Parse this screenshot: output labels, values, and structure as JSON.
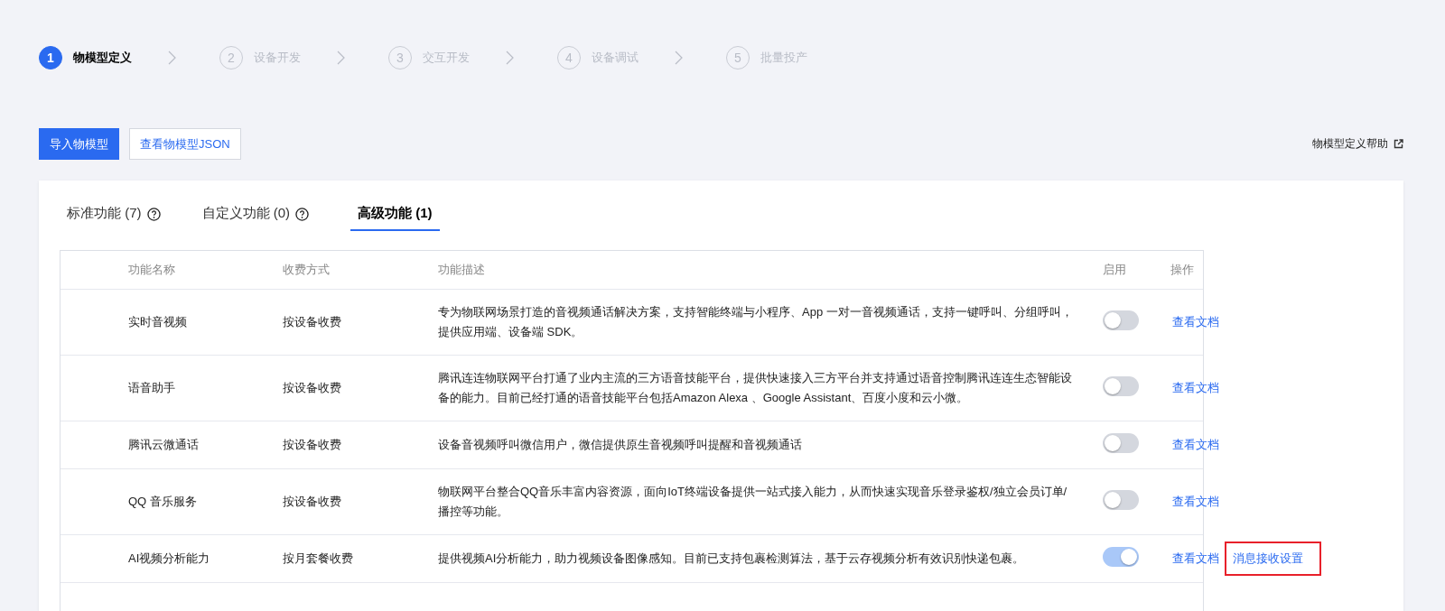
{
  "steps": [
    {
      "number": "1",
      "label": "物模型定义",
      "selected": true
    },
    {
      "number": "2",
      "label": "设备开发",
      "selected": false
    },
    {
      "number": "3",
      "label": "交互开发",
      "selected": false
    },
    {
      "number": "4",
      "label": "设备调试",
      "selected": false
    },
    {
      "number": "5",
      "label": "批量投产",
      "selected": false
    }
  ],
  "toolbar": {
    "buttons": [
      {
        "label": "导入物模型",
        "kind": "primary"
      },
      {
        "label": "查看物模型JSON",
        "kind": "secondary"
      }
    ],
    "help_link": "物模型定义帮助"
  },
  "tabs": [
    {
      "label": "标准功能 (7)",
      "selected": false,
      "help": true
    },
    {
      "label": "自定义功能 (0)",
      "selected": false,
      "help": true
    },
    {
      "label": "高级功能 (1)",
      "selected": true,
      "help": false
    }
  ],
  "table": {
    "columns": [
      "功能名称",
      "收费方式",
      "功能描述",
      "启用",
      "操作"
    ],
    "rows": [
      {
        "name": "实时音视频",
        "billing": "按设备收费",
        "description": "专为物联网场景打造的音视频通话解决方案，支持智能终端与小程序、App 一对一音视频通话，支持一键呼叫、分组呼叫，提供应用端、设备端 SDK。",
        "on": false,
        "actions": [
          {
            "label": "查看文档",
            "highlighted": false
          }
        ]
      },
      {
        "name": "语音助手",
        "billing": "按设备收费",
        "description": "腾讯连连物联网平台打通了业内主流的三方语音技能平台，提供快速接入三方平台并支持通过语音控制腾讯连连生态智能设备的能力。目前已经打通的语音技能平台包括Amazon Alexa 、Google Assistant、百度小度和云小微。",
        "on": false,
        "actions": [
          {
            "label": "查看文档",
            "highlighted": false
          }
        ]
      },
      {
        "name": "腾讯云微通话",
        "billing": "按设备收费",
        "description": "设备音视频呼叫微信用户，微信提供原生音视频呼叫提醒和音视频通话",
        "on": false,
        "actions": [
          {
            "label": "查看文档",
            "highlighted": false
          }
        ]
      },
      {
        "name": "QQ 音乐服务",
        "billing": "按设备收费",
        "description": "物联网平台整合QQ音乐丰富内容资源，面向IoT终端设备提供一站式接入能力，从而快速实现音乐登录鉴权/独立会员订单/播控等功能。",
        "on": false,
        "actions": [
          {
            "label": "查看文档",
            "highlighted": false
          }
        ]
      },
      {
        "name": "AI视频分析能力",
        "billing": "按月套餐收费",
        "description": "提供视频AI分析能力，助力视频设备图像感知。目前已支持包裹检测算法，基于云存视频分析有效识别快递包裹。",
        "on": true,
        "actions": [
          {
            "label": "查看文档",
            "highlighted": false
          },
          {
            "label": "消息接收设置",
            "highlighted": true
          }
        ]
      }
    ]
  }
}
